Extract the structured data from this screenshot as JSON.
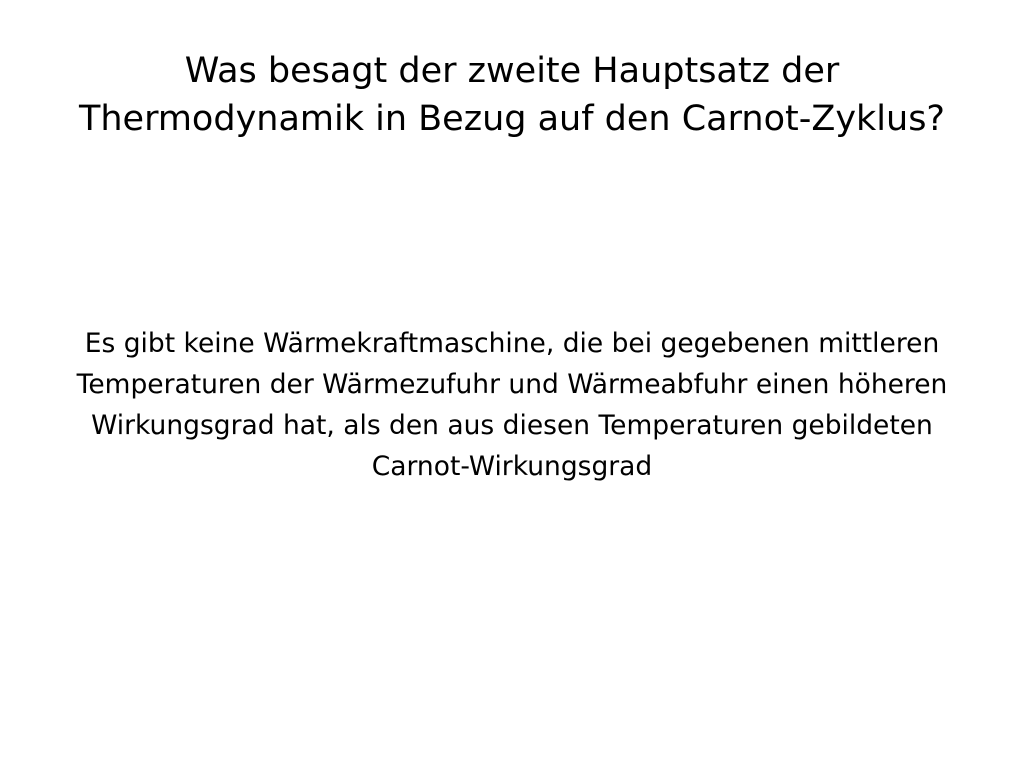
{
  "card": {
    "question_lines": [
      "Was besagt der zweite Hauptsatz der",
      "Thermodynamik in Bezug auf den Carnot-Zyklus?"
    ],
    "answer_lines": [
      "Es gibt keine Wärmekraftmaschine, die bei gegebenen mittleren",
      "Temperaturen der Wärmezufuhr und Wärmeabfuhr einen höheren",
      "Wirkungsgrad hat, als den aus diesen Temperaturen gebildeten",
      "Carnot-Wirkungsgrad"
    ]
  }
}
